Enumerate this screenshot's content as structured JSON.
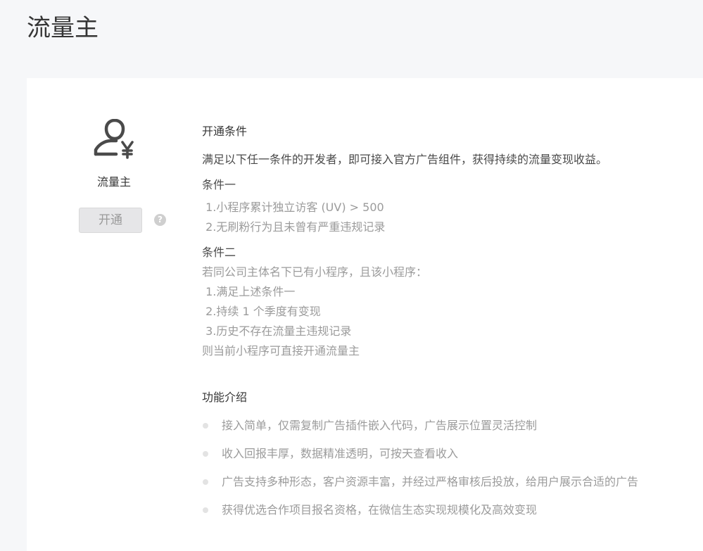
{
  "page": {
    "title": "流量主"
  },
  "side": {
    "icon": "user-yen-icon",
    "name": "流量主",
    "open_label": "开通",
    "help_glyph": "?"
  },
  "conditions": {
    "title": "开通条件",
    "desc": "满足以下任一条件的开发者，即可接入官方广告组件，获得持续的流量变现收益。",
    "cond1": {
      "title": "条件一",
      "items": [
        " 1.小程序累计独立访客 (UV) > 500",
        " 2.无刷粉行为且未曾有严重违规记录"
      ]
    },
    "cond2": {
      "title": "条件二",
      "intro": "若同公司主体名下已有小程序，且该小程序：",
      "items": [
        " 1.满足上述条件一",
        " 2.持续 1 个季度有变现",
        " 3.历史不存在流量主违规记录"
      ],
      "outro": "则当前小程序可直接开通流量主"
    }
  },
  "features": {
    "title": "功能介绍",
    "items": [
      "接入简单，仅需复制广告插件嵌入代码，广告展示位置灵活控制",
      "收入回报丰厚，数据精准透明，可按天查看收入",
      "广告支持多种形态，客户资源丰富，并经过严格审核后投放，给用户展示合适的广告",
      "获得优选合作项目报名资格，在微信生态实现规模化及高效变现"
    ]
  },
  "colors": {
    "background": "#f6f7f9",
    "card": "#ffffff",
    "text": "#353535",
    "muted": "#9b9b9b",
    "button_bg": "#e6e6e8",
    "icon": "#353535"
  }
}
